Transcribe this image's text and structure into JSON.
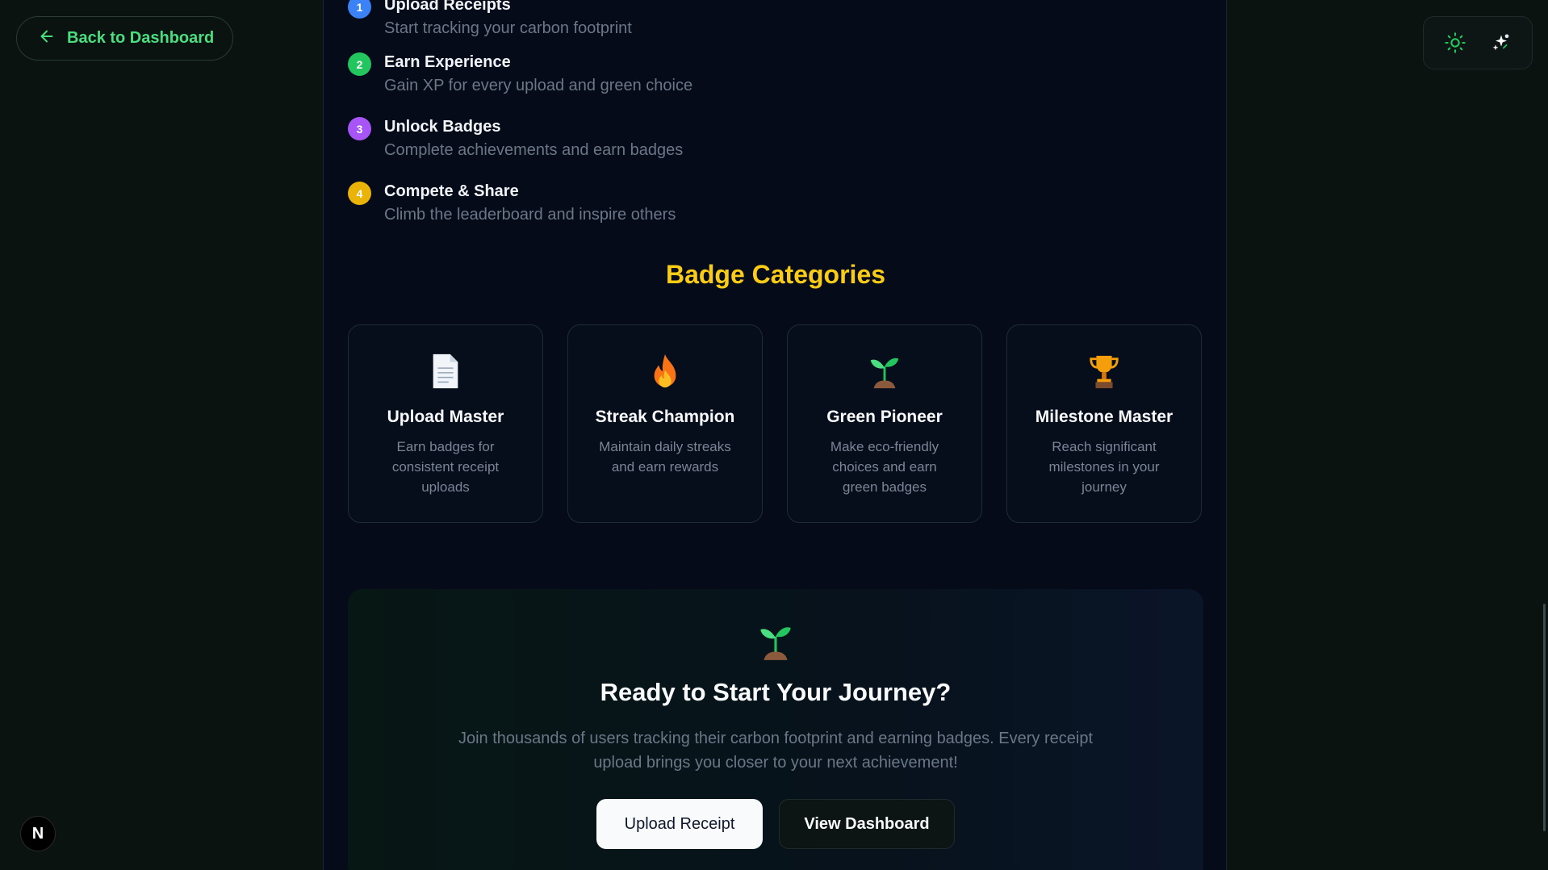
{
  "nav": {
    "back_label": "Back to Dashboard"
  },
  "controls": {
    "theme_icon": "sun-icon",
    "avatar_icon": "sparkle-avatar-icon"
  },
  "steps": [
    {
      "num": "1",
      "title": "Upload Receipts",
      "desc": "Start tracking your carbon footprint",
      "color": "#3b82f6"
    },
    {
      "num": "2",
      "title": "Earn Experience",
      "desc": "Gain XP for every upload and green choice",
      "color": "#22c55e"
    },
    {
      "num": "3",
      "title": "Unlock Badges",
      "desc": "Complete achievements and earn badges",
      "color": "#a855f7"
    },
    {
      "num": "4",
      "title": "Compete & Share",
      "desc": "Climb the leaderboard and inspire others",
      "color": "#eab308"
    }
  ],
  "badge_section": {
    "title": "Badge Categories",
    "cards": [
      {
        "icon": "document-icon",
        "title": "Upload Master",
        "desc": "Earn badges for consistent receipt uploads"
      },
      {
        "icon": "fire-icon",
        "title": "Streak Champion",
        "desc": "Maintain daily streaks and earn rewards"
      },
      {
        "icon": "seedling-icon",
        "title": "Green Pioneer",
        "desc": "Make eco-friendly choices and earn green badges"
      },
      {
        "icon": "trophy-icon",
        "title": "Milestone Master",
        "desc": "Reach significant milestones in your journey"
      }
    ]
  },
  "cta": {
    "icon": "seedling-icon",
    "title": "Ready to Start Your Journey?",
    "desc": "Join thousands of users tracking their carbon footprint and earning badges. Every receipt upload brings you closer to your next achievement!",
    "primary_label": "Upload Receipt",
    "secondary_label": "View Dashboard"
  },
  "dev_badge": {
    "label": "N"
  }
}
